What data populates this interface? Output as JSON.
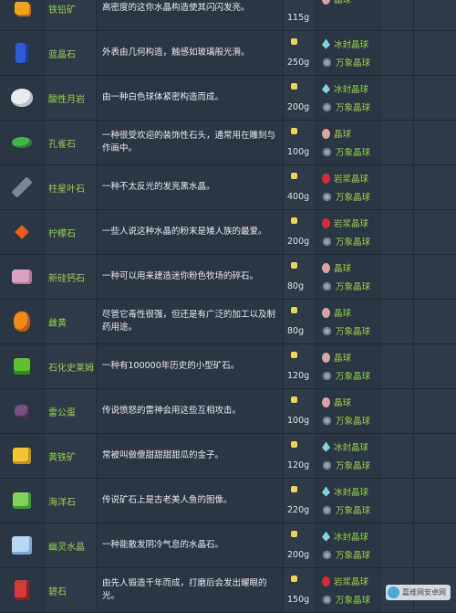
{
  "rows": [
    {
      "name": "铁铅矿",
      "desc": "高密度的这你水晶构造使其闪闪发亮。",
      "price": "115g",
      "loot": [
        {
          "icon": "geode-ball",
          "color": "#d8a4a4",
          "label": "晶球"
        }
      ]
    },
    {
      "name": "蓝晶石",
      "desc": "外表由几何构造，触感如玻璃般光滑。",
      "price": "250g",
      "loot": [
        {
          "icon": "frozen-geode",
          "color": "#7fd6e0",
          "label": "冰封晶球"
        },
        {
          "icon": "omni-geode",
          "color": "#9aa3ad",
          "label": "万象晶球"
        }
      ]
    },
    {
      "name": "酸性月岩",
      "desc": "由一种白色球体紧密构造而成。",
      "price": "200g",
      "loot": [
        {
          "icon": "frozen-geode",
          "color": "#7fd6e0",
          "label": "冰封晶球"
        },
        {
          "icon": "omni-geode",
          "color": "#9aa3ad",
          "label": "万象晶球"
        }
      ]
    },
    {
      "name": "孔雀石",
      "desc": "一种很受欢迎的装饰性石头，通常用在雕刻与作画中。",
      "price": "100g",
      "loot": [
        {
          "icon": "geode-ball",
          "color": "#d8a4a4",
          "label": "晶球"
        },
        {
          "icon": "omni-geode",
          "color": "#9aa3ad",
          "label": "万象晶球"
        }
      ]
    },
    {
      "name": "柱星叶石",
      "desc": "一种不太反光的发亮黑水晶。",
      "price": "400g",
      "loot": [
        {
          "icon": "magma-geode",
          "color": "#d42c3a",
          "label": "岩浆晶球"
        },
        {
          "icon": "omni-geode",
          "color": "#9aa3ad",
          "label": "万象晶球"
        }
      ]
    },
    {
      "name": "柠檬石",
      "desc": "一些人说这种水晶的粉末是矮人族的最爱。",
      "price": "200g",
      "loot": [
        {
          "icon": "magma-geode",
          "color": "#d42c3a",
          "label": "岩浆晶球"
        },
        {
          "icon": "omni-geode",
          "color": "#9aa3ad",
          "label": "万象晶球"
        }
      ]
    },
    {
      "name": "新硅钙石",
      "desc": "一种可以用来建造迷你粉色牧场的碎石。",
      "price": "80g",
      "loot": [
        {
          "icon": "geode-ball",
          "color": "#d8a4a4",
          "label": "晶球"
        },
        {
          "icon": "omni-geode",
          "color": "#9aa3ad",
          "label": "万象晶球"
        }
      ]
    },
    {
      "name": "雌黄",
      "desc": "尽管它毒性很强，但还是有广泛的加工以及制药用途。",
      "price": "80g",
      "loot": [
        {
          "icon": "geode-ball",
          "color": "#d8a4a4",
          "label": "晶球"
        },
        {
          "icon": "omni-geode",
          "color": "#9aa3ad",
          "label": "万象晶球"
        }
      ]
    },
    {
      "name": "石化史莱姆",
      "desc": "一种有100000年历史的小型矿石。",
      "price": "120g",
      "loot": [
        {
          "icon": "geode-ball",
          "color": "#d8a4a4",
          "label": "晶球"
        },
        {
          "icon": "omni-geode",
          "color": "#9aa3ad",
          "label": "万象晶球"
        }
      ]
    },
    {
      "name": "雷公蛋",
      "desc": "传说愤怒的雷神会用这些互相攻击。",
      "price": "100g",
      "loot": [
        {
          "icon": "geode-ball",
          "color": "#d8a4a4",
          "label": "晶球"
        },
        {
          "icon": "omni-geode",
          "color": "#9aa3ad",
          "label": "万象晶球"
        }
      ]
    },
    {
      "name": "黄铁矿",
      "desc": "常被叫做傻甜甜甜甜瓜的金子。",
      "price": "120g",
      "loot": [
        {
          "icon": "frozen-geode",
          "color": "#7fd6e0",
          "label": "冰封晶球"
        },
        {
          "icon": "omni-geode",
          "color": "#9aa3ad",
          "label": "万象晶球"
        }
      ]
    },
    {
      "name": "海洋石",
      "desc": "传说矿石上是古老美人鱼的图像。",
      "price": "220g",
      "loot": [
        {
          "icon": "frozen-geode",
          "color": "#7fd6e0",
          "label": "冰封晶球"
        },
        {
          "icon": "omni-geode",
          "color": "#9aa3ad",
          "label": "万象晶球"
        }
      ]
    },
    {
      "name": "幽灵水晶",
      "desc": "一种能散发阴冷气息的水晶石。",
      "price": "200g",
      "loot": [
        {
          "icon": "frozen-geode",
          "color": "#7fd6e0",
          "label": "冰封晶球"
        },
        {
          "icon": "omni-geode",
          "color": "#9aa3ad",
          "label": "万象晶球"
        }
      ]
    },
    {
      "name": "碧石",
      "desc": "由先人锻造千年而成，打磨后会发出耀眼的光。",
      "price": "150g",
      "loot": [
        {
          "icon": "magma-geode",
          "color": "#d42c3a",
          "label": "岩浆晶球"
        },
        {
          "icon": "omni-geode",
          "color": "#9aa3ad",
          "label": "万象晶球"
        }
      ]
    }
  ],
  "watermark": {
    "label": "嘉维网安卓网"
  },
  "colors": {
    "name_green": "#9bcf4d",
    "coin": "#f1d35b"
  }
}
